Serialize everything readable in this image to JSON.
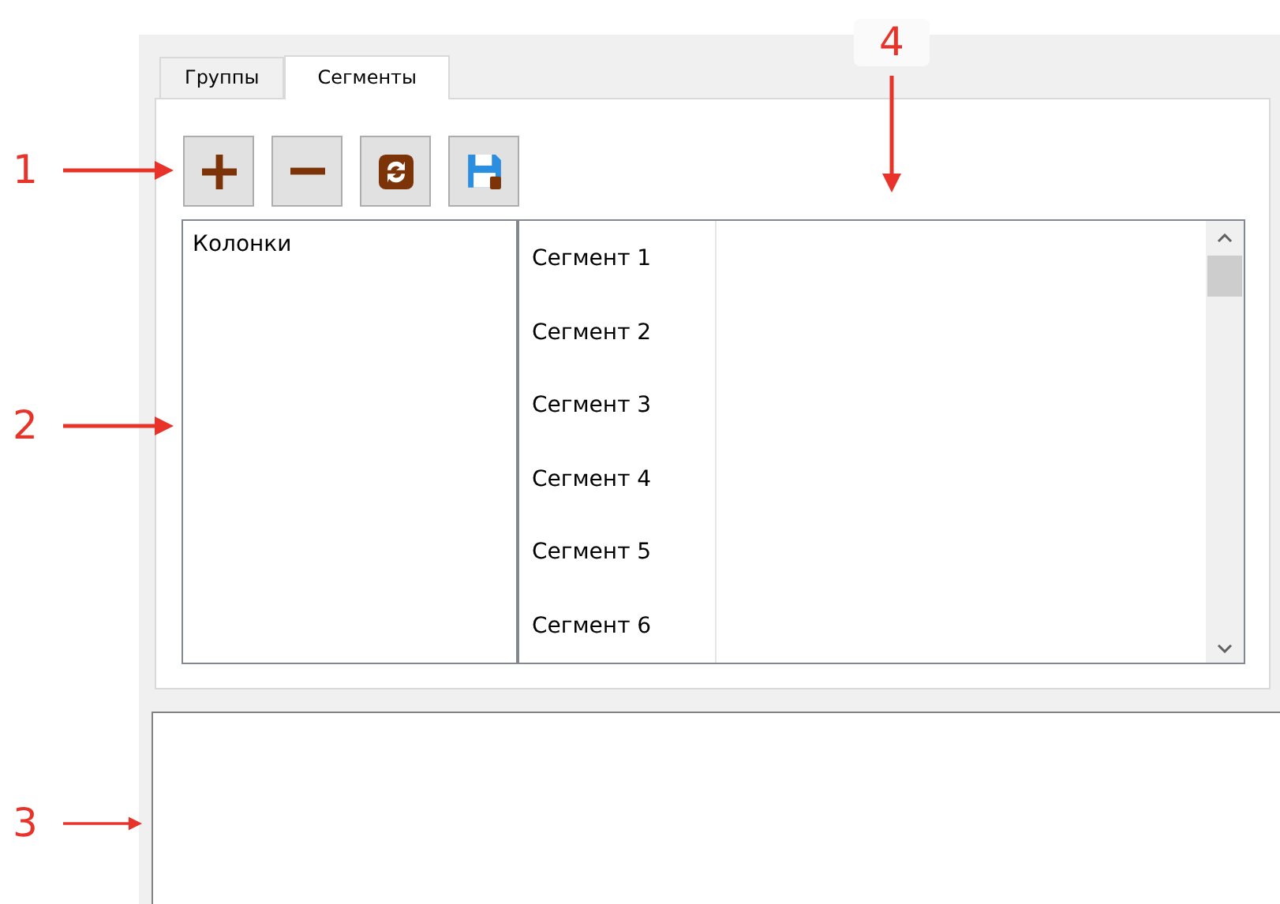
{
  "tabs": [
    {
      "label": "Группы",
      "selected": false
    },
    {
      "label": "Сегменты",
      "selected": true
    }
  ],
  "toolbar": [
    {
      "kind": "add"
    },
    {
      "kind": "remove"
    },
    {
      "kind": "refresh"
    },
    {
      "kind": "save"
    }
  ],
  "columns_list": {
    "items": [
      {
        "label": "Колонки"
      }
    ]
  },
  "segments": [
    {
      "label": "Сегмент 1"
    },
    {
      "label": "Сегмент 2"
    },
    {
      "label": "Сегмент 3"
    },
    {
      "label": "Сегмент 4"
    },
    {
      "label": "Сегмент 5"
    },
    {
      "label": "Сегмент 6"
    }
  ],
  "callouts": [
    {
      "label": "1",
      "kind": "right"
    },
    {
      "label": "2",
      "kind": "right"
    },
    {
      "label": "3",
      "kind": "right"
    },
    {
      "label": "4",
      "kind": "down"
    }
  ]
}
